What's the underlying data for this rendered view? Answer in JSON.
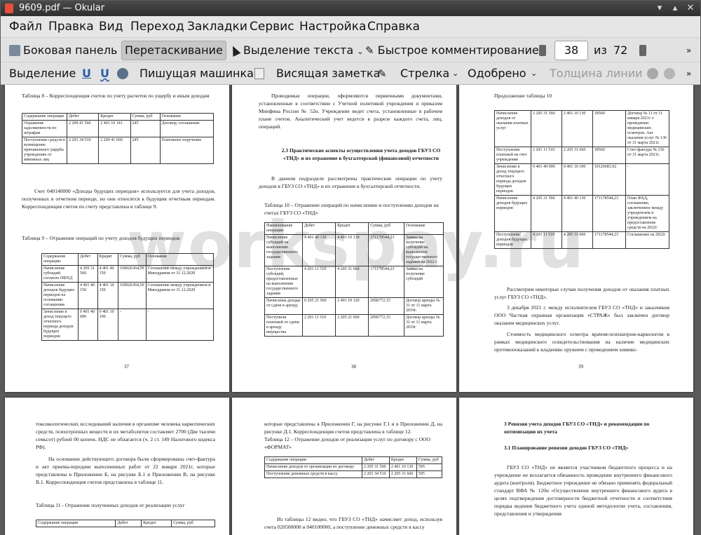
{
  "window": {
    "title": "9609.pdf — Okular"
  },
  "menu": [
    "Файл",
    "Правка",
    "Вид",
    "Переход",
    "Закладки",
    "Сервис",
    "Настройка",
    "Справка"
  ],
  "toolbar1": {
    "sidebar": "Боковая панель",
    "drag": "Перетаскивание",
    "text_select": "Выделение текста",
    "quick_comment": "Быстрое комментирование",
    "page_current": "38",
    "page_of": "из",
    "page_total": "72"
  },
  "toolbar2": {
    "selection": "Выделение",
    "underline1": "U",
    "underline2": "U",
    "typewriter": "Пишущая машинка",
    "sticky_note": "Висящая заметка",
    "arrow": "Стрелка",
    "approved": "Одобрено",
    "line_width": "Толщина линии"
  },
  "watermark": "workspay.ru",
  "pages": {
    "p37": {
      "number": "37",
      "t8_caption": "Таблица 8 – Корреспонденция счетов по учету расчетов по ущербу и иным доходам",
      "t8_head": [
        "Содержание операции",
        "Дебет",
        "Кредит",
        "Сумма, руб",
        "Основание"
      ],
      "t8_rows": [
        [
          "Отражение задолженности по штрафам",
          "2 209 41 560",
          "2 401 10 141",
          "245",
          "Договор, соглашение"
        ],
        [
          "Поступление средств в возмещение причиненного ущерба учреждению от виновных лиц",
          "2 201 34 510",
          "2 209 41 660",
          "245",
          "Платежное поручение"
        ]
      ],
      "para1": "Счет 040140000 «Доходы будущих периодов» используется для учета доходов, полученных в отчетном периоде, но они относятся к будущим отчетным периодам. Корреспонденция счетов по счету представлена в таблице 9.",
      "t9_caption": "Таблица 9 – Отражение операций по учету доходов будущих периодов",
      "t9_head": [
        "Содержание операции",
        "Дебет",
        "Кредит",
        "Сумма, руб",
        "Основание"
      ],
      "t9_rows": [
        [
          "Начисление субсидий согласно ПФХД",
          "4 205 31 560",
          "4 401 40 150",
          "169026364,50",
          "Соглашение между учреждением и Минздравом от 31.12.2020"
        ],
        [
          "Начисление доходов будущих периодов на основании соглашения",
          "4 401 40 150",
          "4 401 10 150",
          "169026364,50",
          "Соглашение между учреждением и Минздравом от 31.12.2020"
        ],
        [
          "Зачисление в доход текущего отчетного периода доходов будущих периодов",
          "0 401 40 000",
          "0 401 10 100",
          "-",
          "-"
        ]
      ]
    },
    "p38": {
      "number": "38",
      "para1": "Проводимые операции, оформляются первичными документами, установленные в соответствии с Учетной политикой учреждения и приказом Минфина России № 52н. Учреждение ведет счета, установленные в рабочем плане счетов. Аналитический учет ведется в разрезе каждого счета, лиц, операций.",
      "heading": "2.3 Практические аспекты осуществления учета доходов ГБУЗ СО «ТНД» и их отражение в бухгалтерской (финансовой) отчетности",
      "para2": "В данном подразделе рассмотрены практические операции по учету доходов в ГБУЗ СО «ТНД» и их отражение в бухгалтерской отчетности.",
      "t10_caption": "Таблица 10 – Отражение операций по начислению и поступлению доходов на счетах ГБУЗ СО «ТНД»",
      "t10_head": [
        "Наименование операции",
        "Дебет",
        "Кредит",
        "Сумма, руб",
        "Основание"
      ],
      "t10_rows": [
        [
          "Начисление субсидий на выполнение государственного задания",
          "4 401 40 130",
          "4 401 10 130",
          "171178544,23",
          "Заявка на получение субсидий на выполнение государственного задания на 2022 г"
        ],
        [
          "Поступление субсидий, предоставленных на выполнение государственного задания",
          "4 201 11 510",
          "4 205 31 660",
          "171178544,23",
          "Заявка на получение субсидий"
        ],
        [
          "Начислены доходы от сдачи в аренду",
          "0 205 21 560",
          "2 401 10 120",
          "2096772,15",
          "Договор аренды № 31 от 11 марта 2019г."
        ],
        [
          "Поступили платежей от сдачи в аренду имущества",
          "2 201 11 510",
          "2 205 21 660",
          "2096772,15",
          "Договор аренды № 31 от 11 марта 2019г"
        ]
      ]
    },
    "p39": {
      "number": "39",
      "caption": "Продолжение таблицы 10",
      "rows": [
        [
          "Начисление доходов от оказания платных услуг",
          "2 205 31 560",
          "2 401 10 130",
          "18560",
          "Договор № 11 от 11 января 2021г о проведении медицинских осмотров. Акт оказания услуг № 136 от 31 марта 2021г."
        ],
        [
          "Поступление платежей на счет учреждения",
          "2 201 11 510",
          "2 205 31 660",
          "18560",
          "Счет-фактура № 136 от 31 марта 2021г."
        ],
        [
          "Зачисление в доход текущего отчетного периода доходов будущих периодов",
          "0 401 40 000",
          "0 401 10 100",
          "19126681,92",
          "-"
        ],
        [
          "Начисление доходов будущих периодов",
          "4 205 31 560",
          "4 401 40 130",
          "171178544,23",
          "План ФХД, соглашение, заключенное между учредителем и учреждением на предоставление средств на 2022г"
        ],
        [
          "Поступление доходов будущих периодов",
          "4 201 11 510",
          "4 205 31 660",
          "171178544,23",
          "Соглашение на 2022г"
        ]
      ],
      "para1": "Рассмотрим некоторые случаи получения доходов от оказания платных услуг ГБУЗ СО «ТНД».",
      "para2": "3 декабря 2021 г. между исполнителем ГБУЗ СО «ТНД» и заказчиком ООО Частная охранная организация «СТРАЖ» был заключен договор оказания медицинских услуг.",
      "para3": "Стоимость медицинского осмотра врачом-психиатром-наркологом в рамках медицинского освидетельствования на наличие медицинских противопоказаний к владению оружием с проведением химико-"
    },
    "p40": {
      "para1": "токсикологических исследований наличия в организме человека наркотических средств, психотропных веществ и их метаболитов составляет 2700 (Две тысячи семьсот) рублей 00 копеек. НДС не облагается (ч. 2 ст. 149 Налогового кодекса РФ).",
      "para2": "На основании действующего договора были сформированы счет-фактура и акт приема-передачи выполненных работ от 22 января 2021г, которые представлены в Приложении Б, на рисунке Б.1 и Приложении В, на рисунке В.1. Корреспонденция счетов представлена в таблице 11.",
      "t11_caption": "Таблица 11 - Отражение полученных доходов от реализации услуг",
      "t11_head": [
        "Содержание операции",
        "Дебет",
        "Кредит",
        "Сумма, руб"
      ]
    },
    "p41": {
      "para1": "которые представлены в Приложении Г, на рисунке Г.1 и в Приложении Д, на рисунке Д.1. Корреспонденция счетов представлена в таблице 12.",
      "t12_caption": "Таблица 12 – Отражение доходов от реализации услуг по договору с ООО «ФОРМАТ»",
      "t12_head": [
        "Содержание операции",
        "Дебет",
        "Кредит",
        "Сумма, руб"
      ],
      "t12_rows": [
        [
          "Начисление доходов от организации по договору",
          "2 205 31 560",
          "2 401 10 130",
          "595"
        ],
        [
          "Поступление денежных средств в кассу",
          "2 201 34 510",
          "2 205 31 660",
          "595"
        ]
      ],
      "para2": "Из таблицы 12 видно, что ГБУЗ СО «ТНД» начисляет доход, используя счета 020500000 и 040100000, а поступление денежных средств в кассу"
    },
    "p42": {
      "heading": "3 Ревизия учета доходов ГБУЗ СО «ТНД» и рекомендации по оптимизации их учета",
      "subheading": "3.1 Планирование ревизии доходов ГБУЗ СО «ТНД»",
      "para1": "ГБУЗ СО «ТНД» не является участником бюджетного процесса и на учреждение не возлагается обязанность проведение внутреннего финансового аудита (контроля). Бюджетное учреждение не обязано применять федеральный стандарт ВФА № 120н «Осуществление внутреннего финансового аудита в целях подтверждения достоверности бюджетной отчетности и соответствия порядка ведения бюджетного учета единой методологии учета, составления, представления и утверждения"
    }
  }
}
